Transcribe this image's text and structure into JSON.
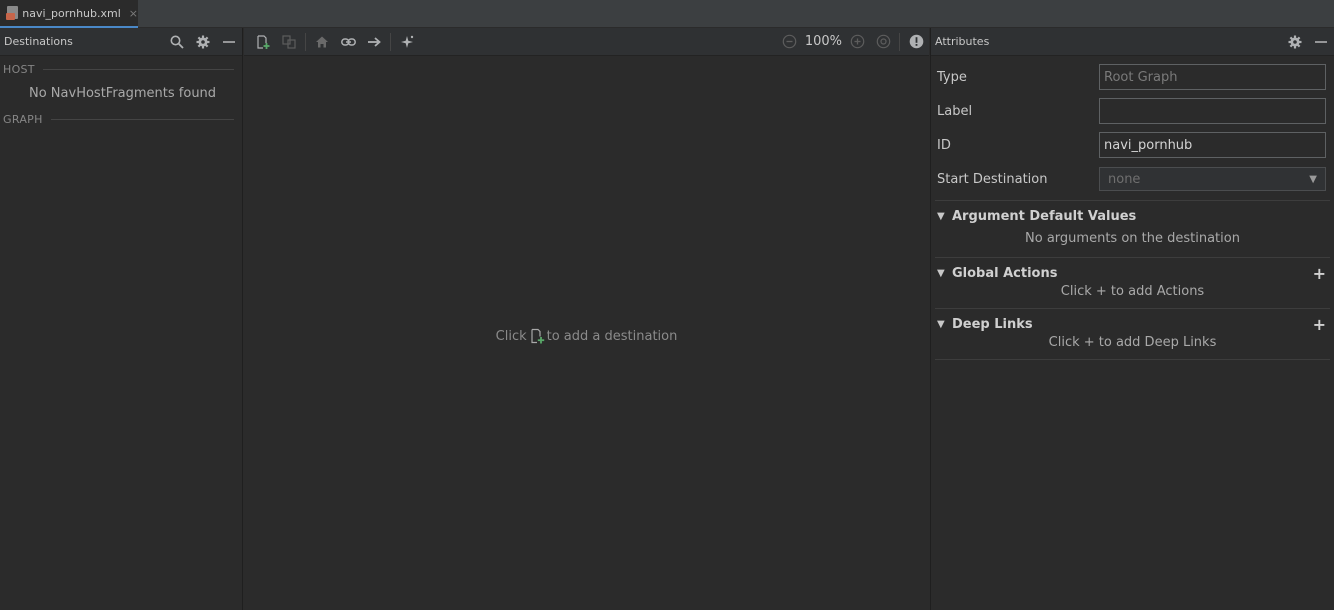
{
  "tab": {
    "label": "navi_pornhub.xml",
    "close": "×"
  },
  "left": {
    "title": "Destinations",
    "host_label": "HOST",
    "host_empty": "No NavHostFragments found",
    "graph_label": "GRAPH"
  },
  "canvas": {
    "zoom": "100%",
    "hint_before": "Click",
    "hint_after": "to add a destination"
  },
  "right": {
    "title": "Attributes",
    "props": {
      "type_label": "Type",
      "type_value": "Root Graph",
      "label_label": "Label",
      "label_value": "",
      "id_label": "ID",
      "id_value": "navi_pornhub",
      "start_label": "Start Destination",
      "start_value": "none"
    },
    "sections": {
      "args_title": "Argument Default Values",
      "args_msg": "No arguments on the destination",
      "actions_title": "Global Actions",
      "actions_msg": "Click + to add Actions",
      "links_title": "Deep Links",
      "links_msg": "Click + to add Deep Links"
    }
  },
  "colors": {
    "background": "#2b2b2b",
    "toolbar": "#2f3133",
    "tab_accent": "#4a88c7",
    "add_green": "#59a869"
  },
  "icons": [
    "file-xml-icon",
    "search-icon",
    "gear-icon",
    "minimize-icon",
    "new-destination-icon",
    "nested-graph-icon",
    "home-icon",
    "link-icon",
    "arrow-right-icon",
    "auto-arrange-icon",
    "zoom-out-icon",
    "zoom-in-icon",
    "zoom-fit-icon",
    "warning-icon",
    "expand-triangle-icon",
    "plus-icon",
    "dropdown-arrow-icon"
  ]
}
